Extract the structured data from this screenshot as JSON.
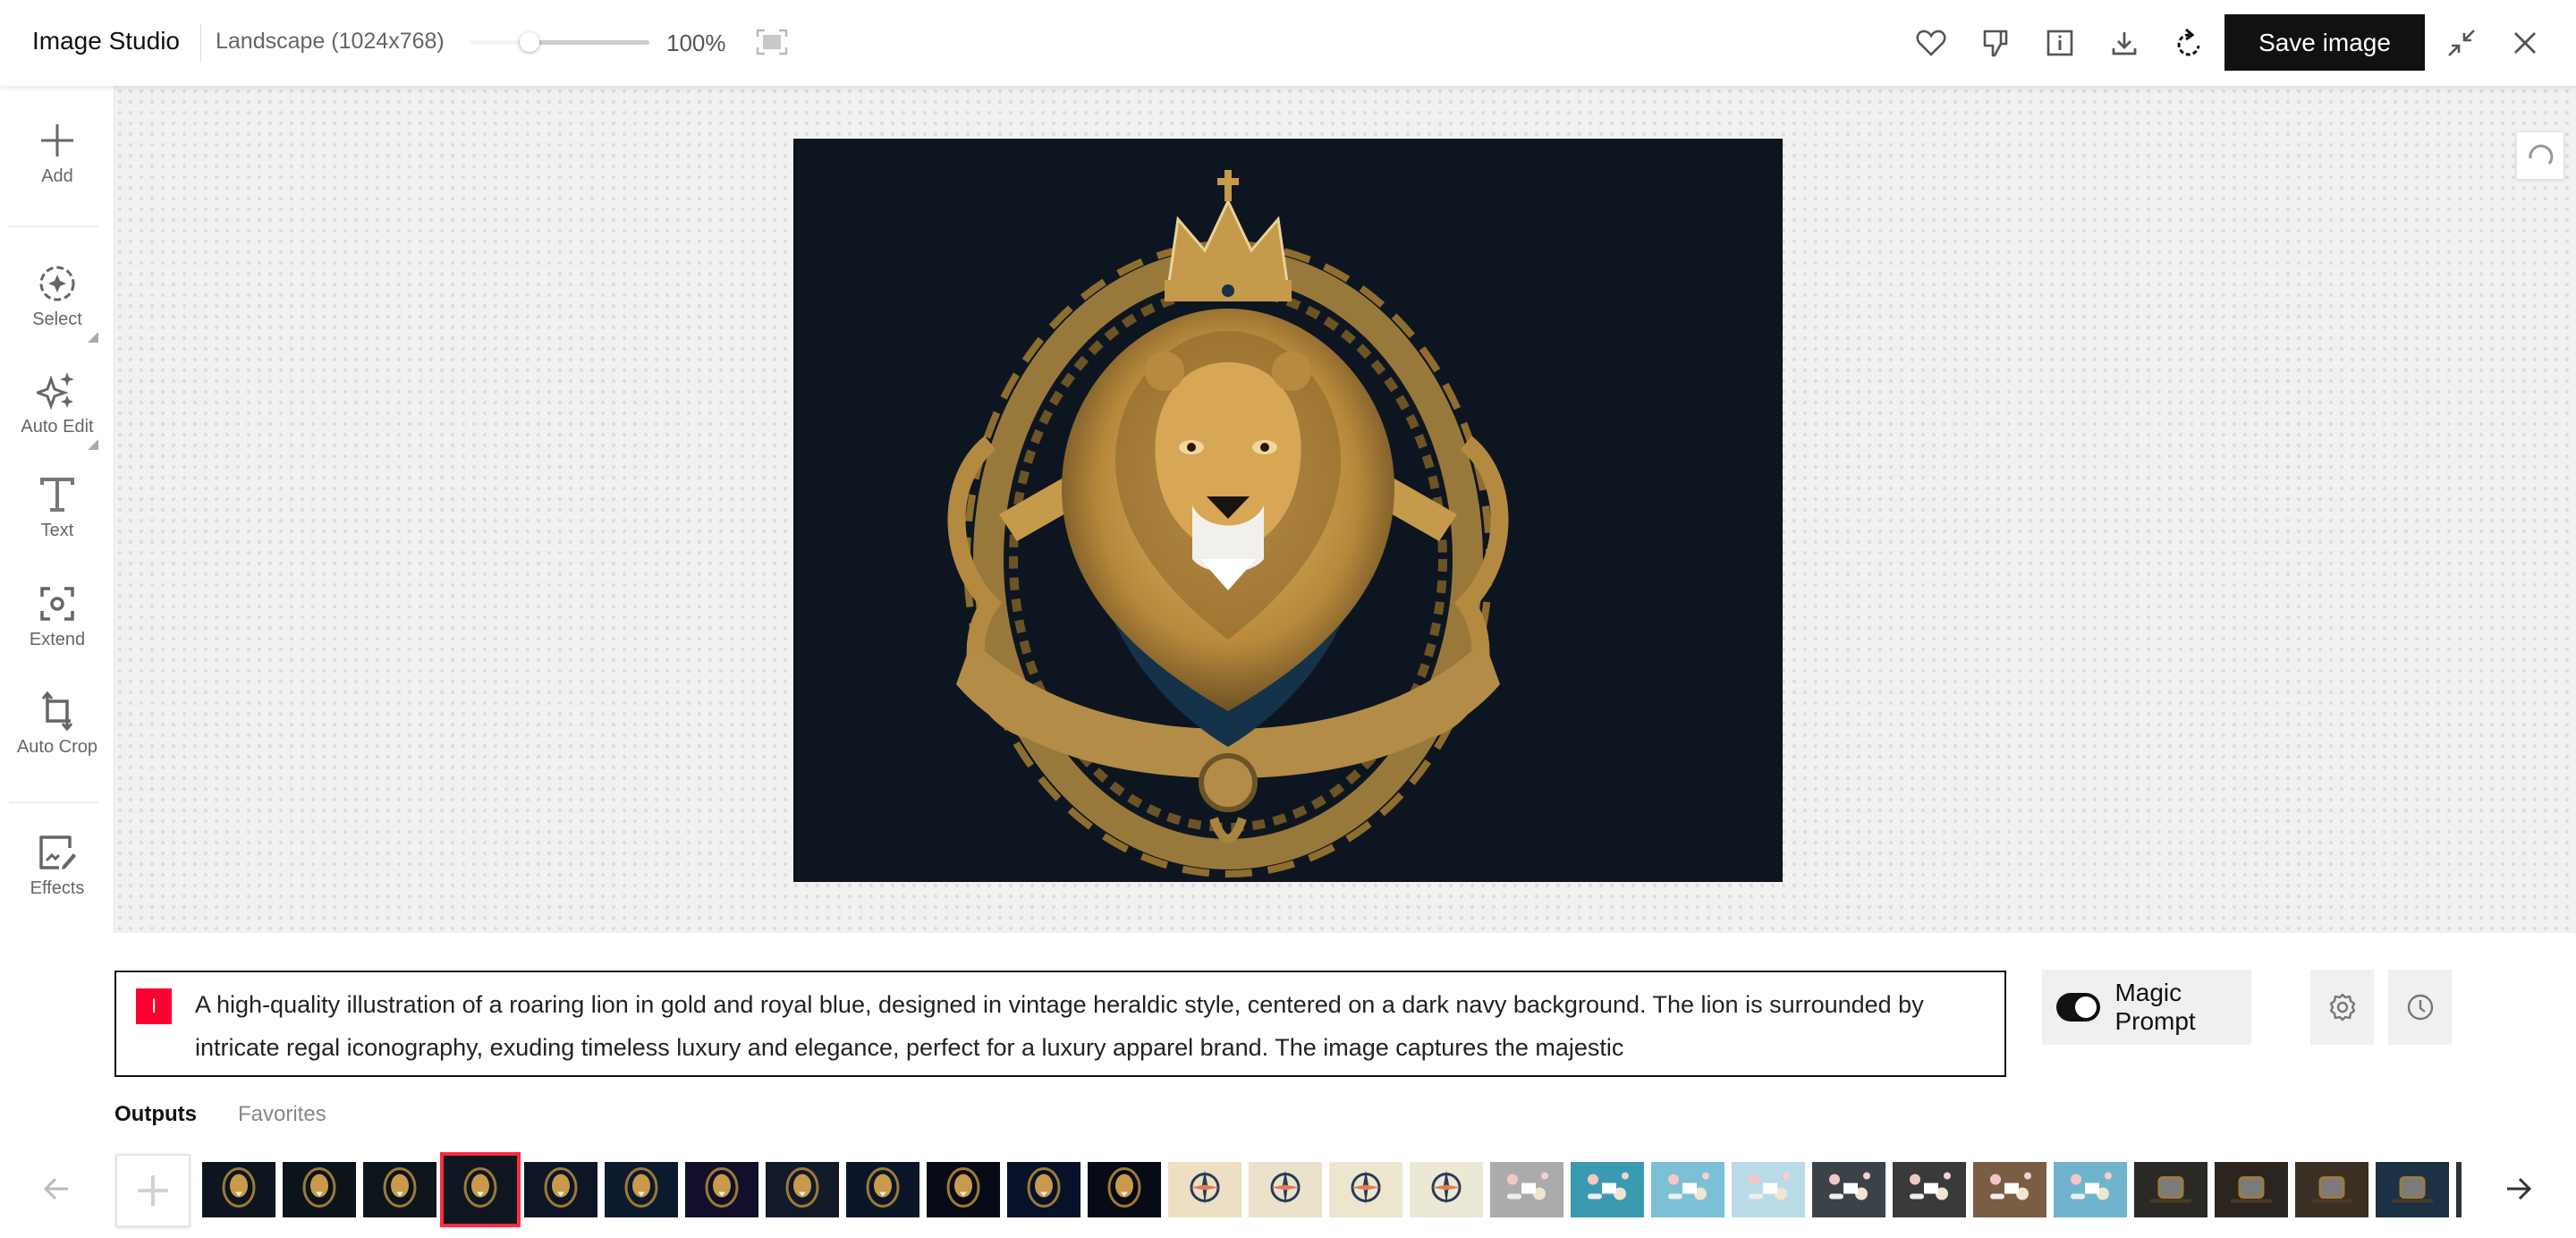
{
  "header": {
    "app_title": "Image Studio",
    "size_label": "Landscape (1024x768)",
    "zoom_value": "100%",
    "zoom_slider_fraction": 0.33,
    "save_label": "Save image",
    "icons": [
      "heart-icon",
      "thumbs-down-icon",
      "info-icon",
      "download-icon",
      "regenerate-icon",
      "collapse-icon",
      "close-icon"
    ]
  },
  "sidebar": {
    "tools": [
      {
        "label": "Add",
        "icon": "plus-icon"
      },
      {
        "label": "Select",
        "icon": "select-sparkle-icon",
        "has_submenu": true
      },
      {
        "label": "Auto Edit",
        "icon": "sparkles-icon",
        "has_submenu": true
      },
      {
        "label": "Text",
        "icon": "text-icon"
      },
      {
        "label": "Extend",
        "icon": "extend-icon"
      },
      {
        "label": "Auto Crop",
        "icon": "crop-icon"
      },
      {
        "label": "Effects",
        "icon": "effects-icon"
      }
    ]
  },
  "canvas": {
    "image_description": "Gold crowned lion crest on dark navy background",
    "image_bg": "#0d1620",
    "accent_gold": "#c9a24f"
  },
  "prompt": {
    "badge": "I",
    "badge_color": "#ff0033",
    "text": "A high-quality illustration of a roaring lion in gold and royal blue, designed in vintage heraldic style, centered on a dark navy background. The lion is surrounded by intricate regal iconography, exuding timeless luxury and elegance, perfect for a luxury apparel brand. The image captures the majestic",
    "magic_prompt_label": "Magic Prompt",
    "magic_prompt_on": true
  },
  "tabs": [
    {
      "label": "Outputs",
      "active": true
    },
    {
      "label": "Favorites",
      "active": false
    }
  ],
  "thumbnails": [
    {
      "kind": "lion",
      "bg": "#0c1520"
    },
    {
      "kind": "lion",
      "bg": "#0b131b"
    },
    {
      "kind": "lion",
      "bg": "#0c141c"
    },
    {
      "kind": "lion",
      "bg": "#0f1620",
      "selected": true
    },
    {
      "kind": "lion",
      "bg": "#0d1526"
    },
    {
      "kind": "lion",
      "bg": "#0c1a2e"
    },
    {
      "kind": "lion",
      "bg": "#120f2a"
    },
    {
      "kind": "lion",
      "bg": "#121a2a"
    },
    {
      "kind": "lion",
      "bg": "#0a1628"
    },
    {
      "kind": "lion",
      "bg": "#070b16"
    },
    {
      "kind": "lion",
      "bg": "#07112a"
    },
    {
      "kind": "lion",
      "bg": "#070b16"
    },
    {
      "kind": "compass",
      "bg": "#ecdfc4"
    },
    {
      "kind": "compass",
      "bg": "#ebe2cc"
    },
    {
      "kind": "compass",
      "bg": "#ece6cf"
    },
    {
      "kind": "compass",
      "bg": "#ece8d6"
    },
    {
      "kind": "spa",
      "bg": "#a9acab"
    },
    {
      "kind": "spa",
      "bg": "#3a9ab2"
    },
    {
      "kind": "spa",
      "bg": "#7cc0d6"
    },
    {
      "kind": "spa",
      "bg": "#b9dbe8"
    },
    {
      "kind": "spa",
      "bg": "#3b4248"
    },
    {
      "kind": "spa",
      "bg": "#3a3a3a"
    },
    {
      "kind": "spa",
      "bg": "#7a5d45"
    },
    {
      "kind": "spa",
      "bg": "#6fb4cc"
    },
    {
      "kind": "speaker",
      "bg": "#2b2926"
    },
    {
      "kind": "speaker",
      "bg": "#2a2520"
    },
    {
      "kind": "speaker",
      "bg": "#3a2f22"
    },
    {
      "kind": "speaker",
      "bg": "#1c3144"
    },
    {
      "kind": "speaker",
      "bg": "#2e3134"
    }
  ]
}
